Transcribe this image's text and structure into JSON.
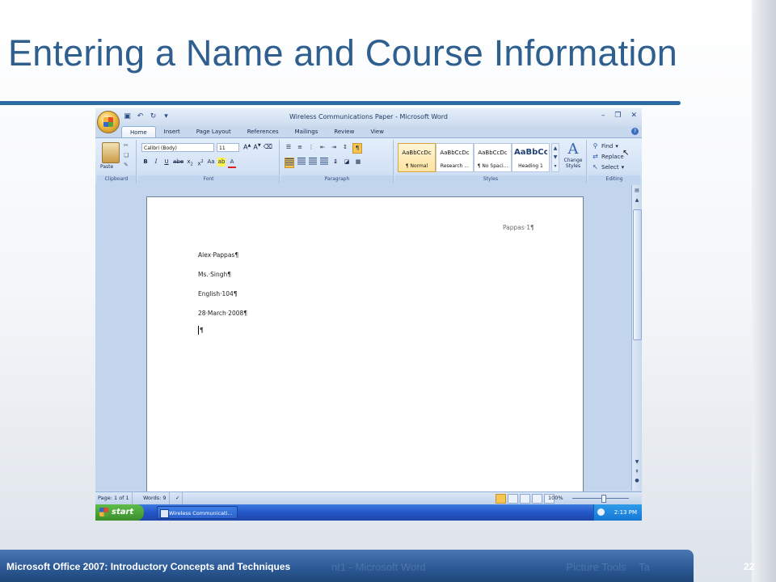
{
  "slide": {
    "title": "Entering a Name and Course Information",
    "footer": "Microsoft Office 2007: Introductory Concepts and Techniques",
    "page_number": "22",
    "footer_bg_text_1": "nt1 - Microsoft Word",
    "footer_bg_text_2": "Picture Tools",
    "footer_bg_text_3": "Ta"
  },
  "word": {
    "window_title": "Wireless Communications Paper - Microsoft Word",
    "tabs": [
      "Home",
      "Insert",
      "Page Layout",
      "References",
      "Mailings",
      "Review",
      "View"
    ],
    "active_tab": "Home",
    "font_name": "Calibri (Body)",
    "font_size": "11",
    "groups": {
      "clipboard": "Clipboard",
      "font": "Font",
      "paragraph": "Paragraph",
      "styles": "Styles",
      "editing": "Editing"
    },
    "paste_label": "Paste",
    "styles": [
      {
        "sample": "AaBbCcDc",
        "name": "¶ Normal"
      },
      {
        "sample": "AaBbCcDc",
        "name": "Research ..."
      },
      {
        "sample": "AaBbCcDc",
        "name": "¶ No Spaci..."
      },
      {
        "sample": "AaBbCc",
        "name": "Heading 1"
      }
    ],
    "change_styles": "Change Styles",
    "editing": {
      "find": "Find",
      "replace": "Replace",
      "select": "Select"
    },
    "document": {
      "header": "Pappas·1¶",
      "lines": [
        "Alex·Pappas¶",
        "Ms.·Singh¶",
        "English·104¶",
        "28·March·2008¶"
      ],
      "cursor_line": "¶"
    },
    "status": {
      "page": "Page: 1 of 1",
      "words": "Words: 9",
      "zoom": "100%"
    },
    "taskbar": {
      "start": "start",
      "item": "Wireless Communicati...",
      "time": "2:13 PM"
    }
  }
}
